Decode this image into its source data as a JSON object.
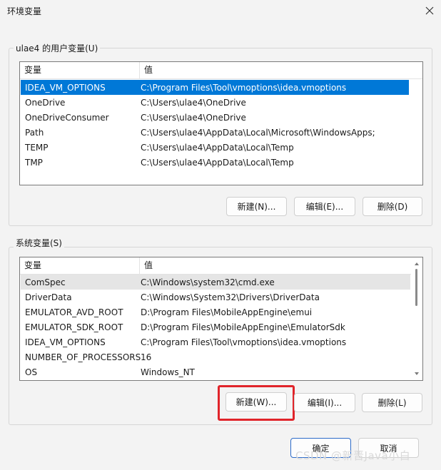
{
  "window": {
    "title": "环境变量"
  },
  "user_vars": {
    "group_label": "ulae4 的用户变量(U)",
    "columns": [
      "变量",
      "值"
    ],
    "rows": [
      {
        "name": "IDEA_VM_OPTIONS",
        "value": "C:\\Program Files\\Tool\\vmoptions\\idea.vmoptions",
        "selected": true
      },
      {
        "name": "OneDrive",
        "value": "C:\\Users\\ulae4\\OneDrive"
      },
      {
        "name": "OneDriveConsumer",
        "value": "C:\\Users\\ulae4\\OneDrive"
      },
      {
        "name": "Path",
        "value": "C:\\Users\\ulae4\\AppData\\Local\\Microsoft\\WindowsApps;"
      },
      {
        "name": "TEMP",
        "value": "C:\\Users\\ulae4\\AppData\\Local\\Temp"
      },
      {
        "name": "TMP",
        "value": "C:\\Users\\ulae4\\AppData\\Local\\Temp"
      }
    ],
    "buttons": {
      "new": "新建(N)...",
      "edit": "编辑(E)...",
      "delete": "删除(D)"
    }
  },
  "system_vars": {
    "group_label": "系统变量(S)",
    "columns": [
      "变量",
      "值"
    ],
    "rows": [
      {
        "name": "ComSpec",
        "value": "C:\\Windows\\system32\\cmd.exe",
        "hover": true
      },
      {
        "name": "DriverData",
        "value": "C:\\Windows\\System32\\Drivers\\DriverData"
      },
      {
        "name": "EMULATOR_AVD_ROOT",
        "value": "D:\\Program Files\\MobileAppEngine\\emui"
      },
      {
        "name": "EMULATOR_SDK_ROOT",
        "value": "D:\\Program Files\\MobileAppEngine\\EmulatorSdk"
      },
      {
        "name": "IDEA_VM_OPTIONS",
        "value": "C:\\Program Files\\Tool\\vmoptions\\idea.vmoptions"
      },
      {
        "name": "NUMBER_OF_PROCESSORS",
        "value": "16"
      },
      {
        "name": "OS",
        "value": "Windows_NT"
      }
    ],
    "buttons": {
      "new": "新建(W)...",
      "edit": "编辑(I)...",
      "delete": "删除(L)"
    }
  },
  "footer": {
    "ok": "确定",
    "cancel": "取消"
  },
  "watermark": "CSDN @新晋Java小白",
  "colors": {
    "selection": "#0078d7",
    "highlight": "#e0242a",
    "primary_border": "#2c6bc9"
  }
}
